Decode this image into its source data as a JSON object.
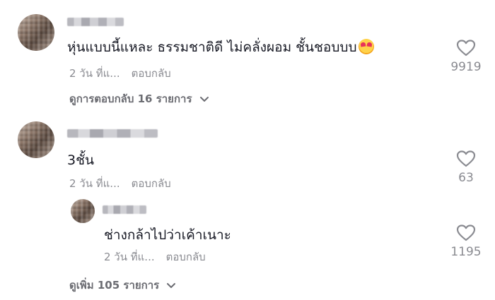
{
  "comments": [
    {
      "text": "หุ่นแบบนี้แหละ ธรรมชาติดี ไม่คลั่งผอม ชั้นชอบบบ",
      "emoji": "smiling-face-with-hearts",
      "time": "2 วัน ที่แ...",
      "reply_label": "ตอบกลับ",
      "likes": "9919",
      "view_replies": "ดูการตอบกลับ 16 รายการ"
    },
    {
      "text": "3ชั้น",
      "time": "2 วัน ที่แ...",
      "reply_label": "ตอบกลับ",
      "likes": "63",
      "reply": {
        "text": "ช่างกล้าไปว่าเค้าเนาะ",
        "time": "2 วัน ที่แ...",
        "reply_label": "ตอบกลับ",
        "likes": "1195"
      },
      "view_more": "ดูเพิ่ม 105 รายการ"
    }
  ],
  "icons": {
    "like": "heart-outline-icon",
    "expand": "chevron-down-icon"
  },
  "colors": {
    "text": "#161823",
    "muted": "#8a8b91",
    "background": "#ffffff"
  }
}
